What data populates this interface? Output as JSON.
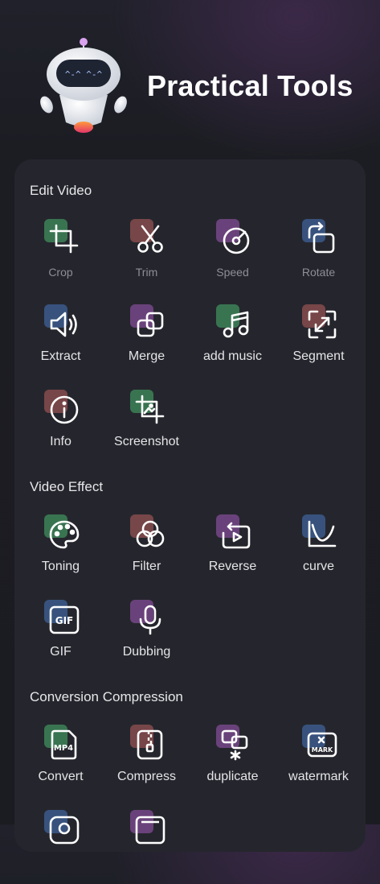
{
  "header": {
    "title": "Practical Tools",
    "robot_eyes": "^-^ ^-^"
  },
  "sections": [
    {
      "title": "Edit Video"
    },
    {
      "title": "Video Effect"
    },
    {
      "title": "Conversion Compression"
    }
  ],
  "tools": {
    "crop": {
      "label": "Crop",
      "icon": "crop-icon",
      "color": "#3f8a5b"
    },
    "trim": {
      "label": "Trim",
      "icon": "scissors-icon",
      "color": "#8e4f4f"
    },
    "speed": {
      "label": "Speed",
      "icon": "speed-icon",
      "color": "#7d4a91"
    },
    "rotate": {
      "label": "Rotate",
      "icon": "rotate-icon",
      "color": "#3e5f94"
    },
    "extract": {
      "label": "Extract",
      "icon": "speaker-icon",
      "color": "#3e5f94"
    },
    "merge": {
      "label": "Merge",
      "icon": "merge-icon",
      "color": "#7d4a91"
    },
    "add_music": {
      "label": "add music",
      "icon": "music-note-icon",
      "color": "#3f8a5b"
    },
    "segment": {
      "label": "Segment",
      "icon": "segment-icon",
      "color": "#8e4f4f"
    },
    "info": {
      "label": "Info",
      "icon": "info-icon",
      "color": "#8e4f4f"
    },
    "screenshot": {
      "label": "Screenshot",
      "icon": "screenshot-icon",
      "color": "#3f8a5b"
    },
    "toning": {
      "label": "Toning",
      "icon": "palette-icon",
      "color": "#3f8a5b"
    },
    "filter": {
      "label": "Filter",
      "icon": "filter-icon",
      "color": "#8e4f4f"
    },
    "reverse": {
      "label": "Reverse",
      "icon": "reverse-icon",
      "color": "#7d4a91"
    },
    "curve": {
      "label": "curve",
      "icon": "curve-icon",
      "color": "#3e5f94"
    },
    "gif": {
      "label": "GIF",
      "icon": "gif-icon",
      "icon_text": "GIF",
      "color": "#3e5f94"
    },
    "dubbing": {
      "label": "Dubbing",
      "icon": "microphone-icon",
      "color": "#7d4a91"
    },
    "convert": {
      "label": "Convert",
      "icon": "mp4-file-icon",
      "icon_text": "MP4",
      "color": "#3f8a5b"
    },
    "compress": {
      "label": "Compress",
      "icon": "zip-file-icon",
      "color": "#8e4f4f"
    },
    "duplicate": {
      "label": "duplicate",
      "icon": "duplicate-icon",
      "color": "#7d4a91"
    },
    "watermark": {
      "label": "watermark",
      "icon": "watermark-icon",
      "icon_text": "MARK",
      "color": "#3e5f94"
    }
  }
}
